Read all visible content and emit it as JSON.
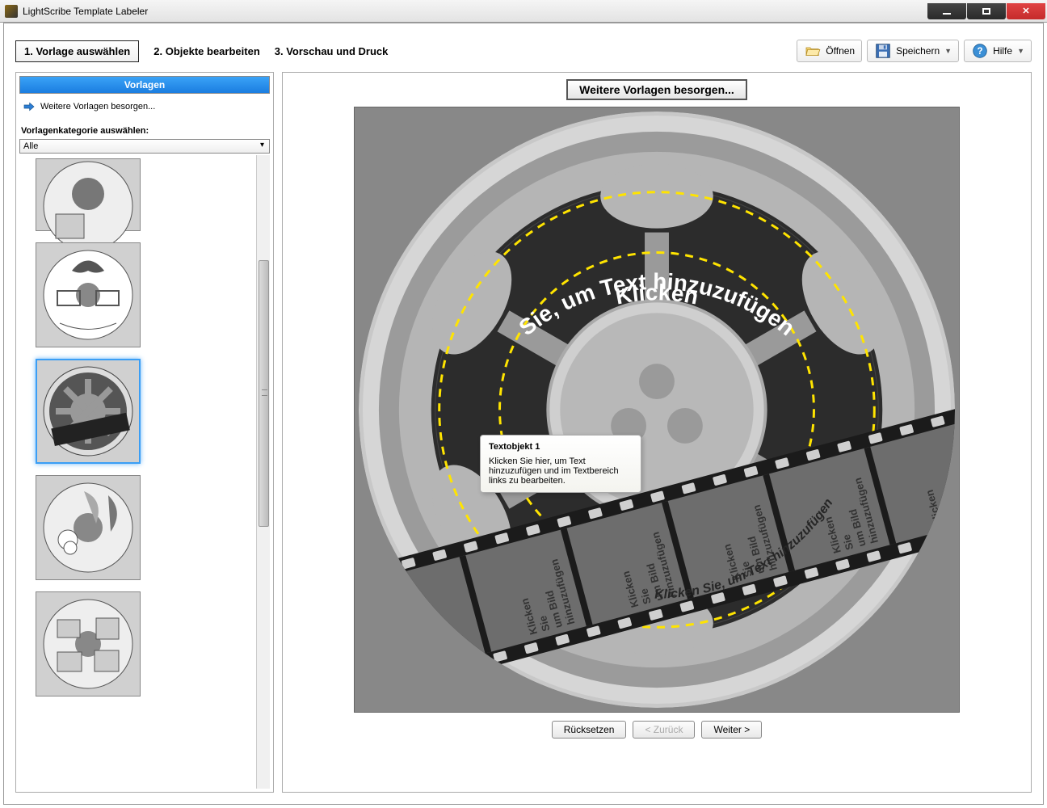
{
  "window": {
    "title": "LightScribe Template Labeler"
  },
  "steps": {
    "s1": "1. Vorlage auswählen",
    "s2": "2. Objekte bearbeiten",
    "s3": "3. Vorschau und Druck"
  },
  "toolbar": {
    "open": "Öffnen",
    "save": "Speichern",
    "help": "Hilfe"
  },
  "sidebar": {
    "header": "Vorlagen",
    "more_link": "Weitere Vorlagen besorgen...",
    "cat_label": "Vorlagenkategorie auswählen:",
    "cat_value": "Alle"
  },
  "canvas": {
    "get_more": "Weitere Vorlagen besorgen...",
    "curved_top_1": "Klicken",
    "curved_top_2": "Sie, um Text hinzuzufügen",
    "curved_bottom": "Klicken Sie, um Text hinzuzufügen",
    "frame_text_l1": "Klicken",
    "frame_text_l2": "Sie",
    "frame_text_l3": "um Bild",
    "frame_text_l4": "hinzuzufügen"
  },
  "tooltip": {
    "title": "Textobjekt 1",
    "body": "Klicken Sie hier, um Text hinzuzufügen und im Textbereich links zu bearbeiten."
  },
  "footer": {
    "reset": "Rücksetzen",
    "back": "< Zurück",
    "next": "Weiter >"
  }
}
